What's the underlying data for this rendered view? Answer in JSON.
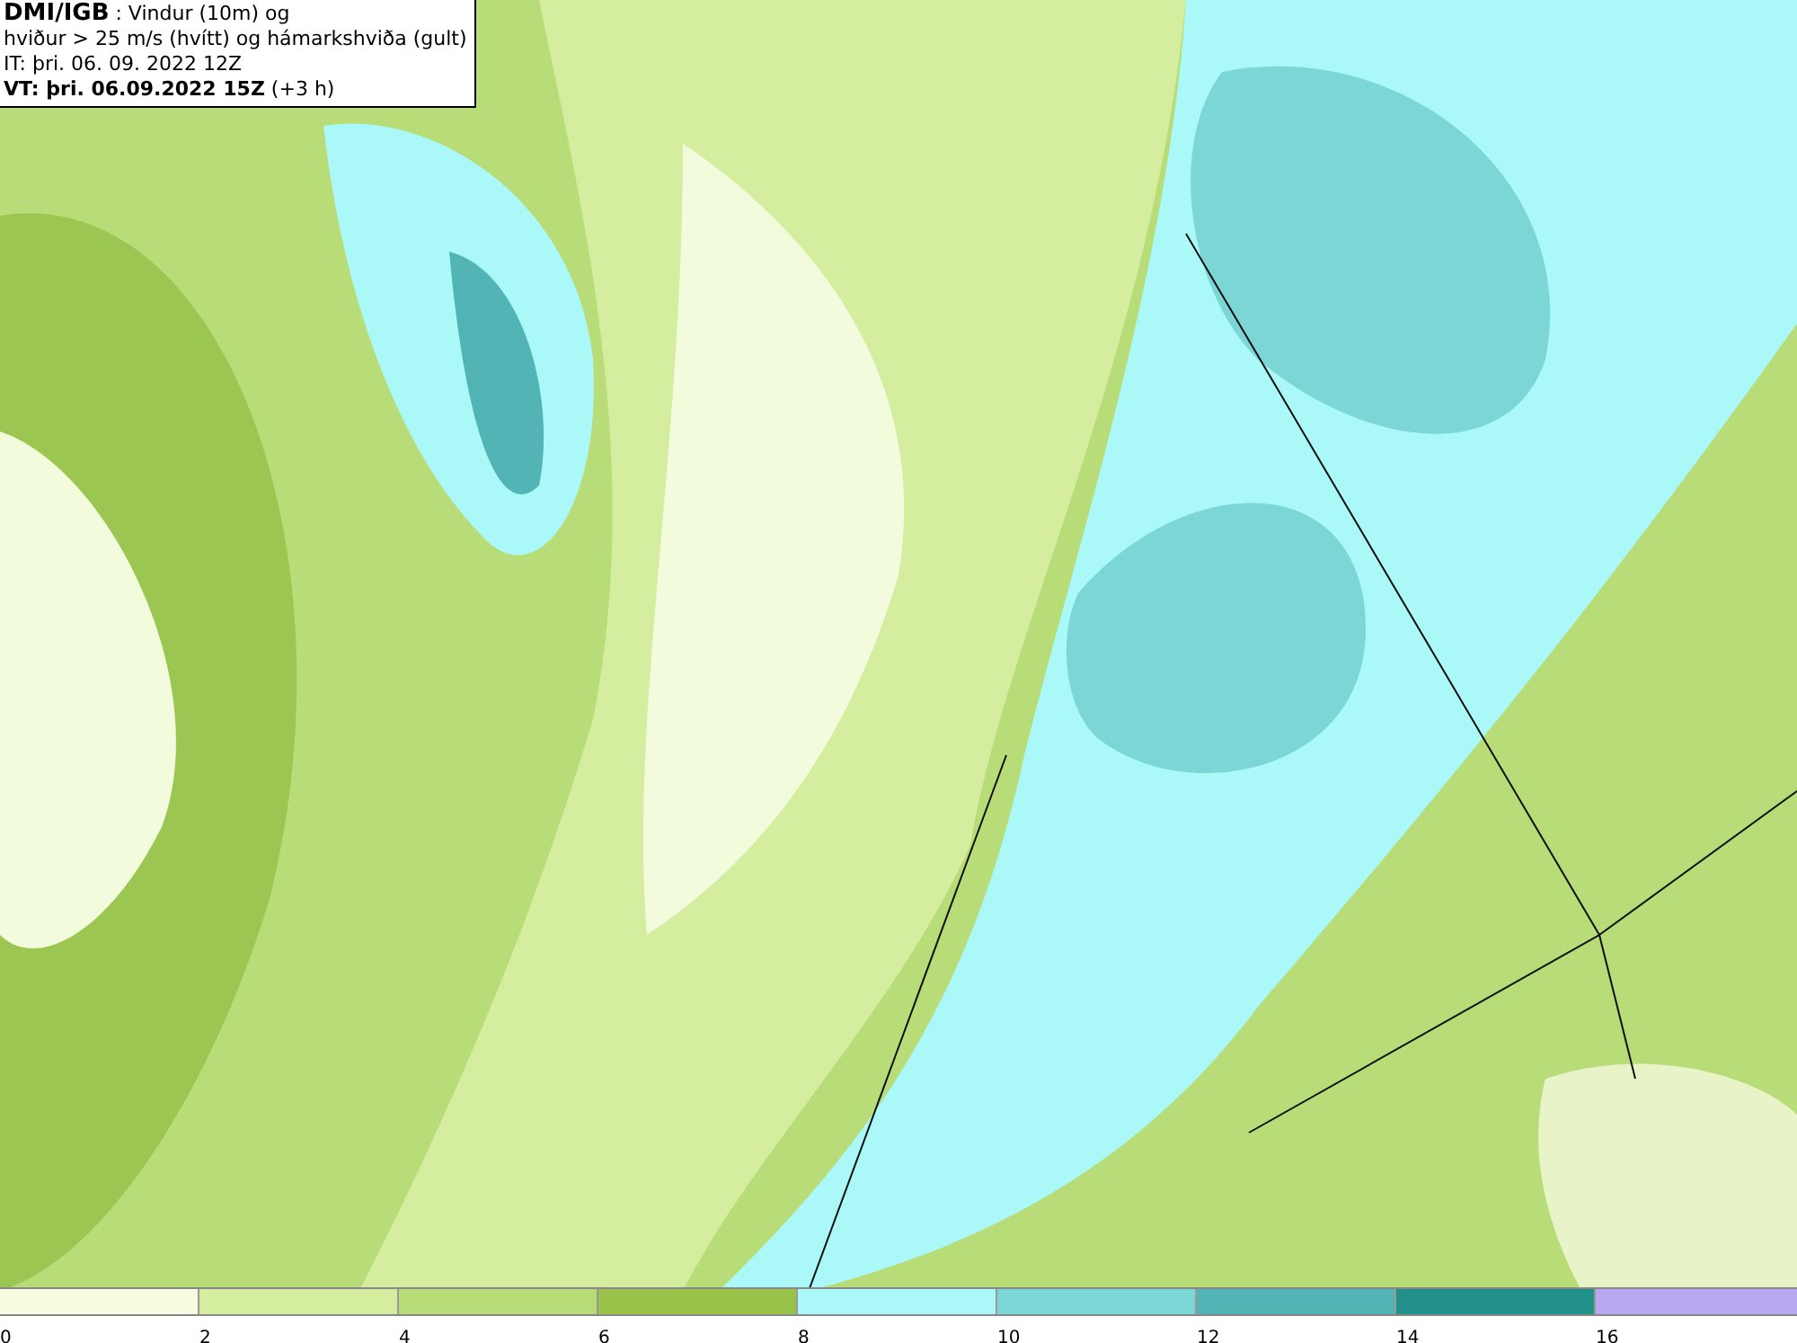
{
  "info_box": {
    "lines": [
      "**DMI/IGB** : Vindur (10m) og",
      "hviður > 25 m/s (hvítt) og hámarkshviða (gult)",
      "IT: þri. 06. 09. 2022 12Z",
      "**VT: þri. 06.09.2022 15Z** (+3 h)"
    ]
  },
  "legend": {
    "segments": [
      {
        "color": "#f5fce0"
      },
      {
        "color": "#d4ed9e"
      },
      {
        "color": "#b8dc78"
      },
      {
        "color": "#98c24a"
      },
      {
        "color": "#aaf8f8"
      },
      {
        "color": "#7cd6d6"
      },
      {
        "color": "#52b4b4"
      },
      {
        "color": "#24908c"
      },
      {
        "color": "#b8a8f0"
      }
    ],
    "labels": [
      "0",
      "2",
      "4",
      "6",
      "8",
      "10",
      "12",
      "14",
      "16"
    ]
  }
}
